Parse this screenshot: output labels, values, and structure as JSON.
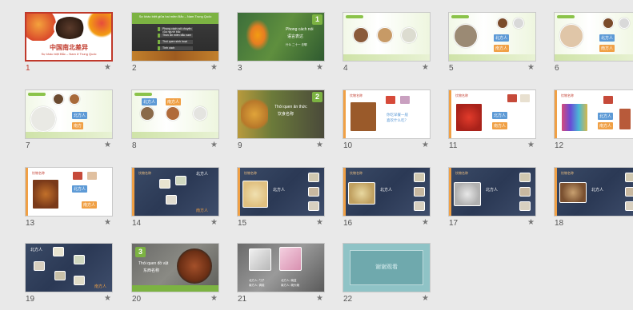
{
  "slides": [
    {
      "number": "1",
      "star": "★",
      "title": "中国南北差异",
      "subtitle": "Sự khác biệt Bắc – Nam ở Trung Quốc"
    },
    {
      "number": "2",
      "star": "★",
      "title": "Sự khác biệt giữa hai miền Bắc – Nam Trung Quốc",
      "items": [
        "Phong cách nói chuyện của người bắc",
        "Thức ăn miền bắc nam",
        "Thói quen sinh hoạt",
        "Tính cách"
      ]
    },
    {
      "number": "3",
      "star": "★",
      "badge": "1",
      "title": "Phong cách nói",
      "title2": "语言表达",
      "sub": "什么 二十一 去哪"
    },
    {
      "number": "4",
      "star": "★"
    },
    {
      "number": "5",
      "star": "★",
      "labels": [
        "北方人",
        "南方人"
      ]
    },
    {
      "number": "6",
      "star": "★",
      "labels": [
        "北方人",
        "南方人"
      ]
    },
    {
      "number": "7",
      "star": "★",
      "labels": [
        "北方人",
        "南方"
      ]
    },
    {
      "number": "8",
      "star": "★",
      "labels": [
        "北方人",
        "南方人"
      ]
    },
    {
      "number": "9",
      "star": "★",
      "badge": "2",
      "title": "Thói quen ăn thức",
      "title2": "饮食名称"
    },
    {
      "number": "10",
      "star": "★",
      "heading": "饮物名称",
      "text": "你吃早餐一般",
      "text2": "喜欢什么吃？"
    },
    {
      "number": "11",
      "star": "★",
      "heading": "饮物名称",
      "labels": [
        "北方人",
        "南方人"
      ]
    },
    {
      "number": "12",
      "star": "★",
      "heading": "饮物名称",
      "labels": [
        "北方人",
        "南方人"
      ]
    },
    {
      "number": "13",
      "star": "★",
      "heading": "饮物名称",
      "labels": [
        "北方人",
        "南方人"
      ]
    },
    {
      "number": "14",
      "star": "★",
      "heading": "饮物名称",
      "north": "北方人",
      "south": "南方人"
    },
    {
      "number": "15",
      "star": "★",
      "heading": "饮物名称",
      "north": "北方人"
    },
    {
      "number": "16",
      "star": "★",
      "heading": "饮物名称",
      "north": "北方人"
    },
    {
      "number": "17",
      "star": "★",
      "heading": "饮物名称",
      "north": "北方人"
    },
    {
      "number": "18",
      "star": "★",
      "heading": "饮物名称",
      "north": "北方人"
    },
    {
      "number": "19",
      "star": "★",
      "north": "北方人",
      "south": "南方人"
    },
    {
      "number": "20",
      "star": "★",
      "badge": "3",
      "title": "Thói quen đồ vật",
      "title2": "东西名称"
    },
    {
      "number": "21",
      "star": "★",
      "cap1": "北方人: 勺子",
      "cap2": "南方人: 调羹",
      "cap3": "北方人: 碗盆",
      "cap4": "南方人: 碗头碗"
    },
    {
      "number": "22",
      "star": "★",
      "text": "谢谢观看"
    }
  ],
  "colors": {
    "selected": "#c0392b",
    "green": "#7cb342",
    "navy": "#2b3955",
    "blue_label": "#5d9ad6",
    "orange_label": "#f0a045"
  }
}
